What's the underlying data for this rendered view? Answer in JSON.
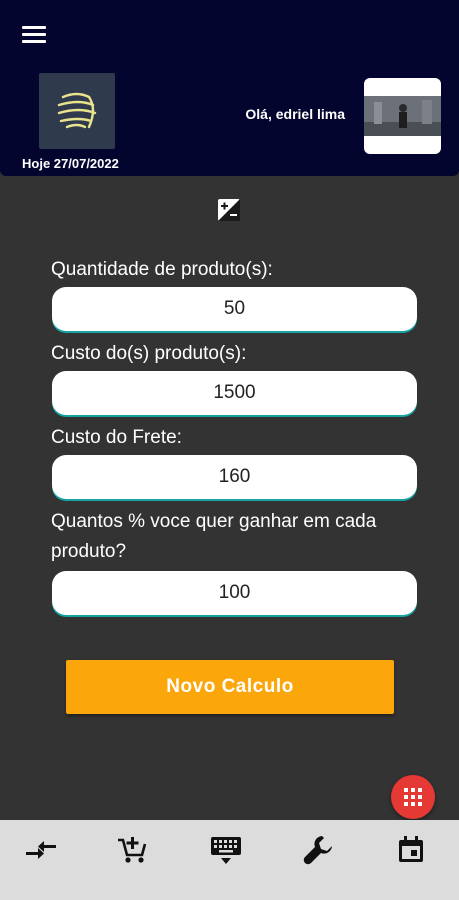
{
  "header": {
    "date": "Hoje 27/07/2022",
    "greeting": "Olá, edriel lima",
    "background": "#03052e"
  },
  "form": {
    "fields": [
      {
        "label": "Quantidade de produto(s):",
        "value": "50"
      },
      {
        "label": "Custo do(s) produto(s):",
        "value": "1500"
      },
      {
        "label": "Custo do Frete:",
        "value": "160"
      },
      {
        "label": "Quantos % voce quer ganhar em cada produto?",
        "value": "100"
      }
    ]
  },
  "actions": {
    "new_calc_label": "Novo Calculo",
    "accent": "#fba60a",
    "fab_color": "#e53935"
  },
  "icons": {
    "menu": "menu-icon",
    "toggle": "plus-minus-icon",
    "fab": "grid-apps-icon",
    "nav": [
      "compare-arrows-icon",
      "add-cart-icon",
      "keyboard-icon",
      "wrench-icon",
      "calendar-icon"
    ]
  }
}
